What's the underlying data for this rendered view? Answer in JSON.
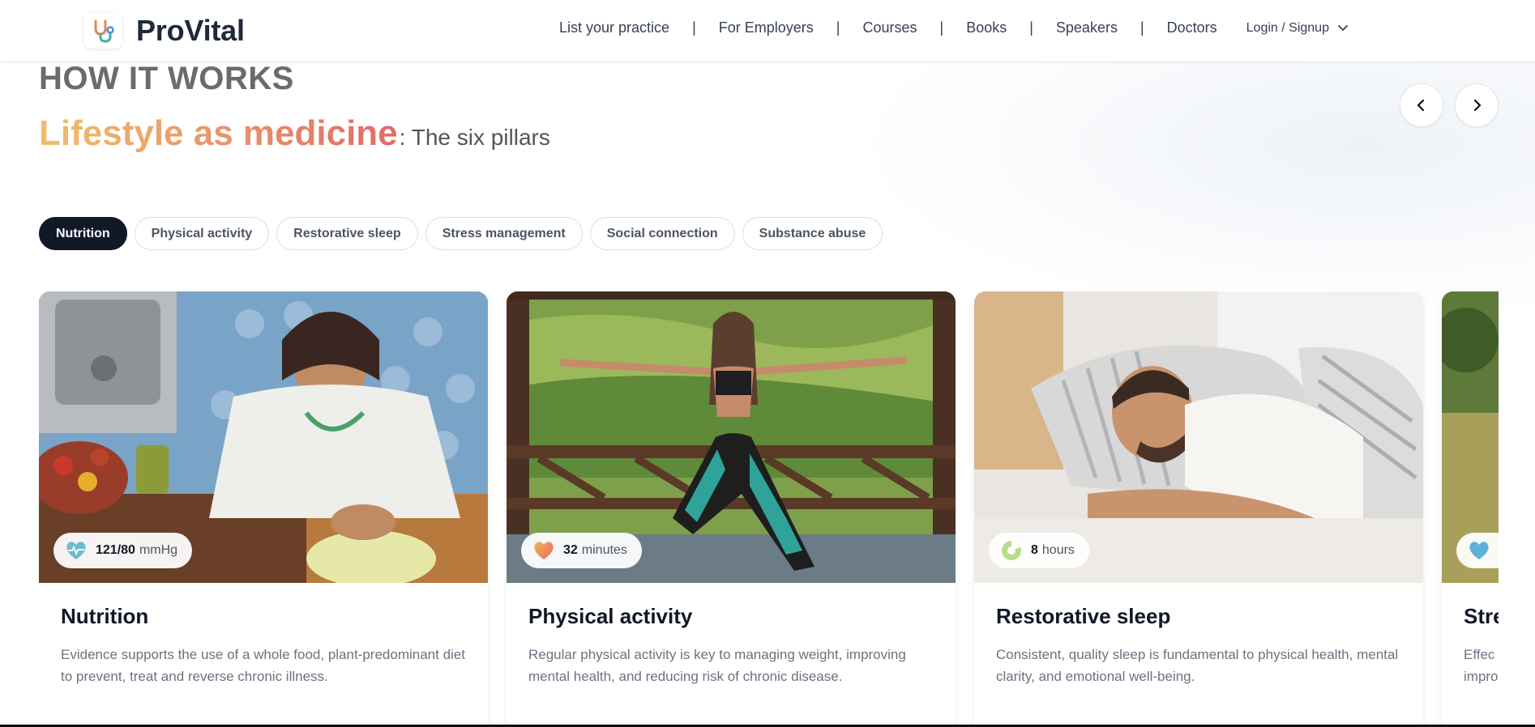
{
  "header": {
    "brand": "ProVital",
    "nav": [
      "List your practice",
      "For Employers",
      "Courses",
      "Books",
      "Speakers",
      "Doctors"
    ],
    "separator": "|",
    "login_label": "Login / Signup"
  },
  "hero": {
    "eyebrow": "HOW IT WORKS",
    "headline_highlight": "Lifestyle as medicine",
    "headline_rest": ": The six pillars"
  },
  "tabs": [
    {
      "label": "Nutrition",
      "active": true
    },
    {
      "label": "Physical activity",
      "active": false
    },
    {
      "label": "Restorative sleep",
      "active": false
    },
    {
      "label": "Stress management",
      "active": false
    },
    {
      "label": "Social connection",
      "active": false
    },
    {
      "label": "Substance abuse",
      "active": false
    }
  ],
  "cards": [
    {
      "title": "Nutrition",
      "badge_value": "121/80",
      "badge_unit": "mmHg",
      "badge_icon": "heartbeat-icon",
      "description": "Evidence supports the use of a whole food, plant-predominant diet to prevent, treat and reverse chronic illness."
    },
    {
      "title": "Physical activity",
      "badge_value": "32",
      "badge_unit": "minutes",
      "badge_icon": "heart-icon",
      "description": "Regular physical activity is key to managing weight, improving mental health, and reducing risk of chronic disease."
    },
    {
      "title": "Restorative sleep",
      "badge_value": "8",
      "badge_unit": "hours",
      "badge_icon": "moon-pie-icon",
      "description": "Consistent, quality sleep is fundamental to physical health, mental clarity, and emotional well-being."
    },
    {
      "title": "Stre",
      "badge_icon": "heart-icon",
      "description_line1": "Effec",
      "description_line2": "impro"
    }
  ],
  "colors": {
    "accent_dark": "#111827",
    "gradient_start": "#f1be6a",
    "gradient_end": "#e06a6a"
  }
}
